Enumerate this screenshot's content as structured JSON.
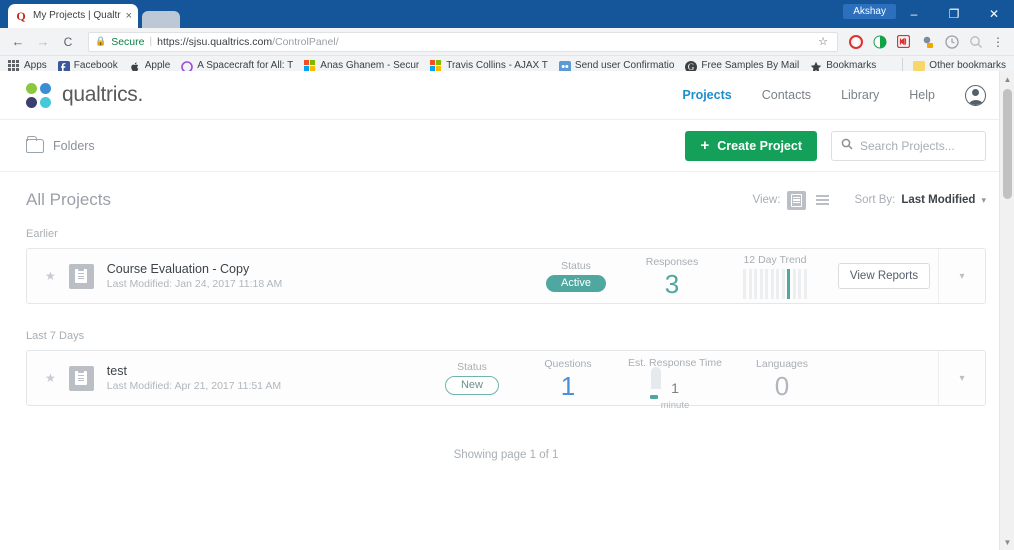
{
  "browser": {
    "tab": {
      "title": "My Projects | Qualtrics Su",
      "favicon": "Q",
      "close_label": "×"
    },
    "window_user": "Akshay",
    "window_buttons": [
      {
        "name": "minimize",
        "glyph": "–"
      },
      {
        "name": "maximize",
        "glyph": "❐"
      },
      {
        "name": "close",
        "glyph": "✕"
      }
    ],
    "nav": {
      "back": "←",
      "forward": "→",
      "reload": "C",
      "secure_label": "Secure",
      "url_domain": "https://sjsu.qualtrics.com",
      "url_path": "/ControlPanel/",
      "star": "☆",
      "menu": "⋮"
    },
    "bookmarks": [
      {
        "label": "Apps",
        "icon": "apps-grid-icon"
      },
      {
        "label": "Facebook",
        "icon": "facebook-icon"
      },
      {
        "label": "Apple",
        "icon": "apple-icon"
      },
      {
        "label": "A Spacecraft for All: T",
        "icon": "circle-icon"
      },
      {
        "label": "Anas Ghanem - Secur",
        "icon": "microsoft-icon"
      },
      {
        "label": "Travis Collins - AJAX T",
        "icon": "microsoft-icon"
      },
      {
        "label": "Send user Confirmatio",
        "icon": "blue-square-icon"
      },
      {
        "label": "Free Samples By Mail",
        "icon": "google-icon"
      },
      {
        "label": "Bookmarks",
        "icon": "star-icon"
      }
    ],
    "other_bookmarks": "Other bookmarks"
  },
  "app": {
    "logo_text": "qualtrics.",
    "logo_colors": [
      "#8dc63f",
      "#3b8ed1",
      "#3b3f6b",
      "#46c8d8"
    ],
    "nav_links": [
      {
        "label": "Projects",
        "active": true
      },
      {
        "label": "Contacts",
        "active": false
      },
      {
        "label": "Library",
        "active": false
      },
      {
        "label": "Help",
        "active": false
      }
    ],
    "avatar": "user-avatar"
  },
  "toolbar": {
    "folders_label": "Folders",
    "create_label": "Create Project",
    "create_color": "#15a05a",
    "search_placeholder": "Search Projects...",
    "search_value": ""
  },
  "section": {
    "title": "All Projects",
    "view_label": "View:",
    "view_modes": [
      {
        "name": "card-view",
        "selected": true
      },
      {
        "name": "list-view",
        "selected": false
      }
    ],
    "sort_label": "Sort By:",
    "sort_value": "Last Modified"
  },
  "groups": [
    {
      "label": "Earlier",
      "projects": [
        {
          "name": "Course Evaluation - Copy",
          "modified": "Last Modified: Jan 24, 2017 11:18 AM",
          "starred": false,
          "stats": [
            {
              "kind": "pill",
              "label": "Status",
              "value": "Active",
              "style": "active"
            },
            {
              "kind": "number",
              "label": "Responses",
              "value": "3",
              "color": "#4fa8a0"
            },
            {
              "kind": "trend",
              "label": "12 Day Trend",
              "bars": [
                1,
                1,
                1,
                1,
                1,
                1,
                1,
                1,
                1,
                1,
                1,
                1
              ],
              "highlight_index": 8
            }
          ],
          "action_label": "View Reports",
          "menu": "⌄"
        }
      ]
    },
    {
      "label": "Last 7 Days",
      "projects": [
        {
          "name": "test",
          "modified": "Last Modified: Apr 21, 2017 11:51 AM",
          "starred": false,
          "stats": [
            {
              "kind": "pill",
              "label": "Status",
              "value": "New",
              "style": "new"
            },
            {
              "kind": "number",
              "label": "Questions",
              "value": "1",
              "color": "#4a90d9"
            },
            {
              "kind": "gauge",
              "label": "Est. Response Time",
              "value": "1",
              "unit": "minute"
            },
            {
              "kind": "number",
              "label": "Languages",
              "value": "0",
              "color": "#b0b6bb"
            }
          ],
          "action_label": "",
          "menu": "⌄"
        }
      ]
    }
  ],
  "footer": {
    "paging": "Showing page 1 of 1"
  }
}
